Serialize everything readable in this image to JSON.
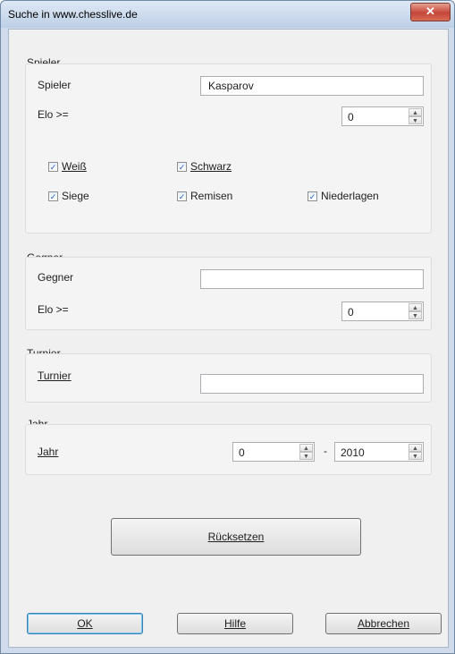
{
  "window": {
    "title": "Suche in www.chesslive.de",
    "close_glyph": "✕"
  },
  "spieler": {
    "group": "Spieler",
    "name_label": "Spieler",
    "name_value": "Kasparov",
    "elo_label": "Elo >=",
    "elo_value": "0",
    "checks": [
      {
        "label": "Weiß",
        "checked": true
      },
      {
        "label": "Schwarz",
        "checked": true
      },
      {
        "label": "Siege",
        "checked": true
      },
      {
        "label": "Remisen",
        "checked": true
      },
      {
        "label": "Niederlagen",
        "checked": true
      }
    ]
  },
  "gegner": {
    "group": "Gegner",
    "name_label": "Gegner",
    "name_value": "",
    "elo_label": "Elo >=",
    "elo_value": "0"
  },
  "turnier": {
    "group": "Turnier",
    "label": "Turnier",
    "value": ""
  },
  "jahr": {
    "group": "Jahr",
    "label": "Jahr",
    "from": "0",
    "sep": "-",
    "to": "2010"
  },
  "buttons": {
    "reset": "Rücksetzen",
    "ok": "OK",
    "help": "Hilfe",
    "cancel": "Abbrechen"
  },
  "icons": {
    "check": "✓",
    "spin_up": "▲",
    "spin_down": "▼"
  }
}
